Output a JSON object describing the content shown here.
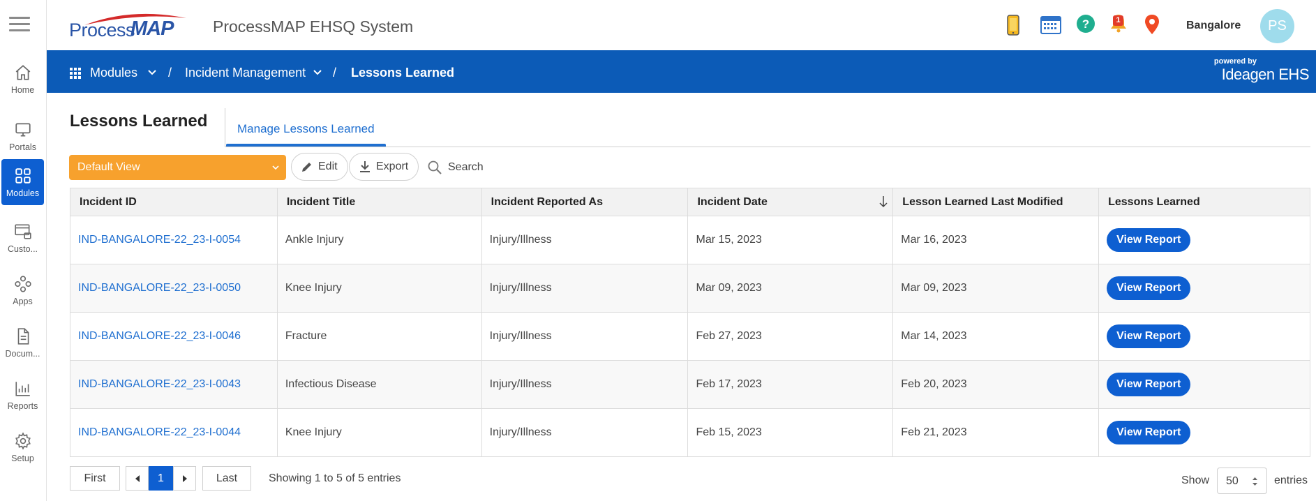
{
  "app": {
    "logo_text_1": "Process",
    "logo_text_2": "MAP",
    "title": "ProcessMAP EHSQ System",
    "location": "Bangalore",
    "avatar_initials": "PS",
    "notification_count": "1"
  },
  "rail": {
    "items": [
      {
        "label": "Home",
        "icon": "home-icon"
      },
      {
        "label": "Portals",
        "icon": "monitor-icon"
      },
      {
        "label": "Modules",
        "icon": "grid-icon",
        "active": true
      },
      {
        "label": "Custo...",
        "icon": "custom-icon"
      },
      {
        "label": "Apps",
        "icon": "apps-icon"
      },
      {
        "label": "Docum...",
        "icon": "document-icon"
      },
      {
        "label": "Reports",
        "icon": "chart-icon"
      },
      {
        "label": "Setup",
        "icon": "gear-icon"
      }
    ]
  },
  "breadcrumb": {
    "modules": "Modules",
    "incident_management": "Incident Management",
    "current": "Lessons Learned",
    "separator": "/"
  },
  "branding": {
    "powered_by": "powered by",
    "brand": "Ideagen EHS"
  },
  "page": {
    "title": "Lessons Learned",
    "tab": "Manage Lessons Learned"
  },
  "toolbar": {
    "view": "Default View",
    "edit": "Edit",
    "export": "Export",
    "search": "Search"
  },
  "table": {
    "columns": [
      "Incident ID",
      "Incident Title",
      "Incident Reported As",
      "Incident Date",
      "Lesson Learned Last Modified",
      "Lessons Learned"
    ],
    "rows": [
      {
        "id": "IND-BANGALORE-22_23-I-0054",
        "title": "Ankle Injury",
        "reported_as": "Injury/Illness",
        "date": "Mar 15, 2023",
        "modified": "Mar 16, 2023",
        "action": "View Report"
      },
      {
        "id": "IND-BANGALORE-22_23-I-0050",
        "title": "Knee Injury",
        "reported_as": "Injury/Illness",
        "date": "Mar 09, 2023",
        "modified": "Mar 09, 2023",
        "action": "View Report"
      },
      {
        "id": "IND-BANGALORE-22_23-I-0046",
        "title": "Fracture",
        "reported_as": "Injury/Illness",
        "date": "Feb 27, 2023",
        "modified": "Mar 14, 2023",
        "action": "View Report"
      },
      {
        "id": "IND-BANGALORE-22_23-I-0043",
        "title": "Infectious Disease",
        "reported_as": "Injury/Illness",
        "date": "Feb 17, 2023",
        "modified": "Feb 20, 2023",
        "action": "View Report"
      },
      {
        "id": "IND-BANGALORE-22_23-I-0044",
        "title": "Knee Injury",
        "reported_as": "Injury/Illness",
        "date": "Feb 15, 2023",
        "modified": "Feb 21, 2023",
        "action": "View Report"
      }
    ]
  },
  "pagination": {
    "first": "First",
    "page": "1",
    "last": "Last",
    "summary": "Showing 1 to 5 of 5 entries",
    "show_label": "Show",
    "page_size": "50",
    "entries_label": "entries"
  },
  "colors": {
    "accent_blue": "#0c5bb7",
    "button_blue": "#0e5fd1",
    "view_orange": "#f7a12d",
    "link_blue": "#1f6fd0"
  }
}
